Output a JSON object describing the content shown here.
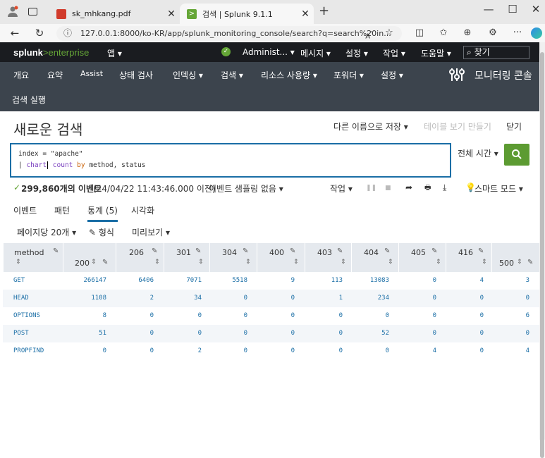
{
  "browser": {
    "tabs": [
      {
        "title": "sk_mhkang.pdf",
        "active": false
      },
      {
        "title": "검색 | Splunk 9.1.1",
        "active": true
      }
    ],
    "url": "127.0.0.1:8000/ko-KR/app/splunk_monitoring_console/search?q=search%20in...",
    "new_tab": "+",
    "window_controls": [
      "—",
      "☐",
      "✕"
    ]
  },
  "splunk": {
    "logo_bold": "splunk",
    "logo_gt": ">",
    "logo_rest": "enterprise",
    "top": {
      "app": "앱 ▾",
      "user": "Administ... ▾",
      "messages": "메시지 ▾",
      "settings": "설정 ▾",
      "activity": "작업 ▾",
      "help": "도움말 ▾",
      "find": "찾기"
    },
    "nav": {
      "items": [
        "개요",
        "요약",
        "Assist",
        "상태 검사",
        "인덱싱 ▾",
        "검색 ▾",
        "리소스 사용량 ▾",
        "포워더 ▾",
        "설정 ▾"
      ],
      "run_search": "검색 실행",
      "app_title": "모니터링 콘솔"
    },
    "page": {
      "title": "새로운 검색",
      "save_as": "다른 이름으로 저장 ▾",
      "make_table": "테이블 보기 만들기",
      "close": "닫기"
    },
    "search": {
      "line1": "index = \"apache\"",
      "line2_prefix": "| ",
      "line2_cmd": "chart",
      "line2_fn": "count",
      "line2_by": "by",
      "line2_rest": "method, status",
      "time_range": "전체 시간 ▾",
      "button_icon": "search-icon"
    },
    "status": {
      "check": "✓",
      "count": "299,860개의 이벤트",
      "time": "(24/04/22 11:43:46.000 이전)",
      "sampling": "이벤트 샘플링 없음 ▾",
      "jobs": "작업 ▾",
      "smart_mode": "스마트 모드 ▾"
    },
    "result_tabs": [
      "이벤트",
      "패턴",
      "통계 (5)",
      "시각화"
    ],
    "options": {
      "per_page": "페이지당 20개 ▾",
      "format": "✎ 형식",
      "preview": "미리보기 ▾"
    },
    "table": {
      "columns": [
        "method",
        "200",
        "206",
        "301",
        "304",
        "400",
        "403",
        "404",
        "405",
        "416",
        "500"
      ],
      "rows": [
        [
          "GET",
          "266147",
          "6406",
          "7071",
          "5518",
          "9",
          "113",
          "13083",
          "0",
          "4",
          "3"
        ],
        [
          "HEAD",
          "1108",
          "2",
          "34",
          "0",
          "0",
          "1",
          "234",
          "0",
          "0",
          "0"
        ],
        [
          "OPTIONS",
          "8",
          "0",
          "0",
          "0",
          "0",
          "0",
          "0",
          "0",
          "0",
          "6"
        ],
        [
          "POST",
          "51",
          "0",
          "0",
          "0",
          "0",
          "0",
          "52",
          "0",
          "0",
          "0"
        ],
        [
          "PROPFIND",
          "0",
          "0",
          "2",
          "0",
          "0",
          "0",
          "0",
          "4",
          "0",
          "4"
        ]
      ]
    }
  },
  "colors": {
    "accent": "#1a6ea6",
    "search_button": "#5c9b32",
    "header_dark": "#1a1c20",
    "nav_bar": "#3c444d"
  }
}
